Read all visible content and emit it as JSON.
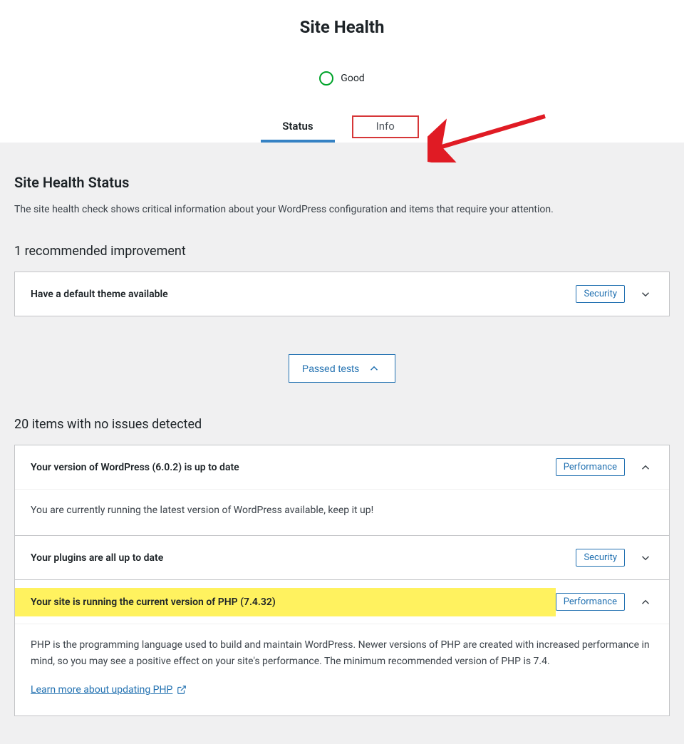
{
  "page_title": "Site Health",
  "gauge": {
    "label": "Good",
    "ring_color": "#00a32a"
  },
  "tabs": {
    "status": "Status",
    "info": "Info"
  },
  "section": {
    "heading": "Site Health Status",
    "description": "The site health check shows critical information about your WordPress configuration and items that require your attention."
  },
  "improvements": {
    "heading": "1 recommended improvement",
    "items": [
      {
        "title": "Have a default theme available",
        "badge": "Security",
        "expanded": false
      }
    ]
  },
  "passed_button": "Passed tests",
  "no_issues": {
    "heading": "20 items with no issues detected",
    "items": [
      {
        "title": "Your version of WordPress (6.0.2) is up to date",
        "badge": "Performance",
        "expanded": true,
        "body": "You are currently running the latest version of WordPress available, keep it up!"
      },
      {
        "title": "Your plugins are all up to date",
        "badge": "Security",
        "expanded": false
      },
      {
        "title": "Your site is running the current version of PHP (7.4.32)",
        "badge": "Performance",
        "expanded": true,
        "highlighted": true,
        "body": "PHP is the programming language used to build and maintain WordPress. Newer versions of PHP are created with increased performance in mind, so you may see a positive effect on your site's performance. The minimum recommended version of PHP is 7.4.",
        "link": "Learn more about updating PHP"
      }
    ]
  }
}
